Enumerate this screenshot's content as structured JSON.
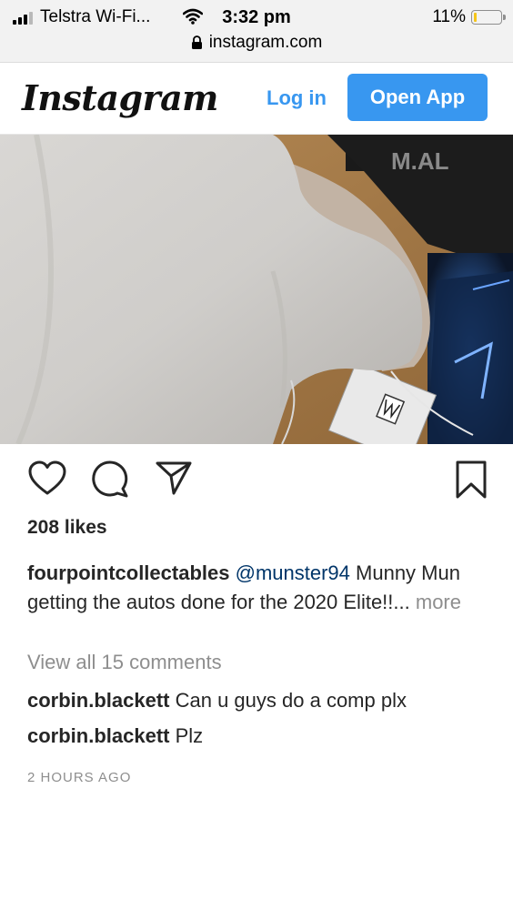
{
  "status_bar": {
    "carrier": "Telstra Wi-Fi...",
    "time": "3:32 pm",
    "battery": "11%",
    "battery_level": 0.11,
    "url": "instagram.com"
  },
  "header": {
    "logo": "Instagram",
    "login_label": "Log in",
    "open_app_label": "Open App"
  },
  "post": {
    "likes": "208 likes",
    "caption": {
      "username": "fourpointcollectables",
      "mention": "@munster94",
      "text": "Munny Mun getting the autos done for the 2020 Elite!!...",
      "more": "more"
    },
    "view_all": "View all 15 comments",
    "comments": [
      {
        "username": "corbin.blackett",
        "text": "Can u guys do a comp plx"
      },
      {
        "username": "corbin.blackett",
        "text": "Plz"
      }
    ],
    "timestamp": "2 HOURS AGO",
    "photo_text": "M.AL"
  },
  "icons": {
    "like": "heart-icon",
    "comment": "comment-icon",
    "share": "share-icon",
    "save": "bookmark-icon",
    "lock": "lock-icon"
  },
  "colors": {
    "accent": "#3897f0",
    "mention": "#003569",
    "muted": "#8e8e8e"
  }
}
